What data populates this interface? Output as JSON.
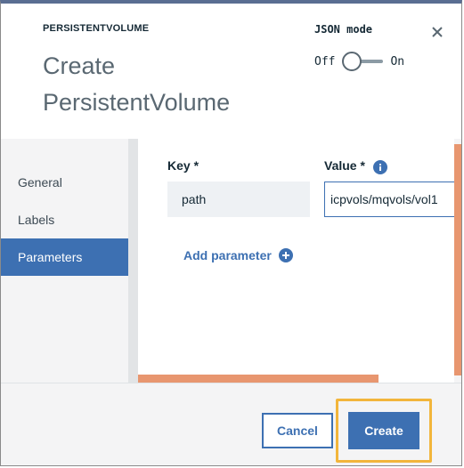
{
  "header": {
    "eyebrow": "PERSISTENTVOLUME",
    "title": "Create PersistentVolume",
    "json_mode_label": "JSON mode",
    "toggle_off": "Off",
    "toggle_on": "On",
    "toggle_state": "off",
    "close_icon": "close-icon"
  },
  "sidebar": {
    "items": [
      {
        "label": "General",
        "active": false
      },
      {
        "label": "Labels",
        "active": false
      },
      {
        "label": "Parameters",
        "active": true
      }
    ]
  },
  "parameters": {
    "key_label": "Key *",
    "value_label": "Value *",
    "info_icon": "info-icon",
    "rows": [
      {
        "key": "path",
        "value": "icpvols/mqvols/vol1"
      }
    ],
    "add_label": "Add parameter",
    "add_icon": "plus-circle-icon"
  },
  "footer": {
    "cancel_label": "Cancel",
    "create_label": "Create"
  },
  "colors": {
    "accent": "#3d70b2",
    "highlight": "#f2b53b",
    "scrollbar": "#e8966f"
  }
}
